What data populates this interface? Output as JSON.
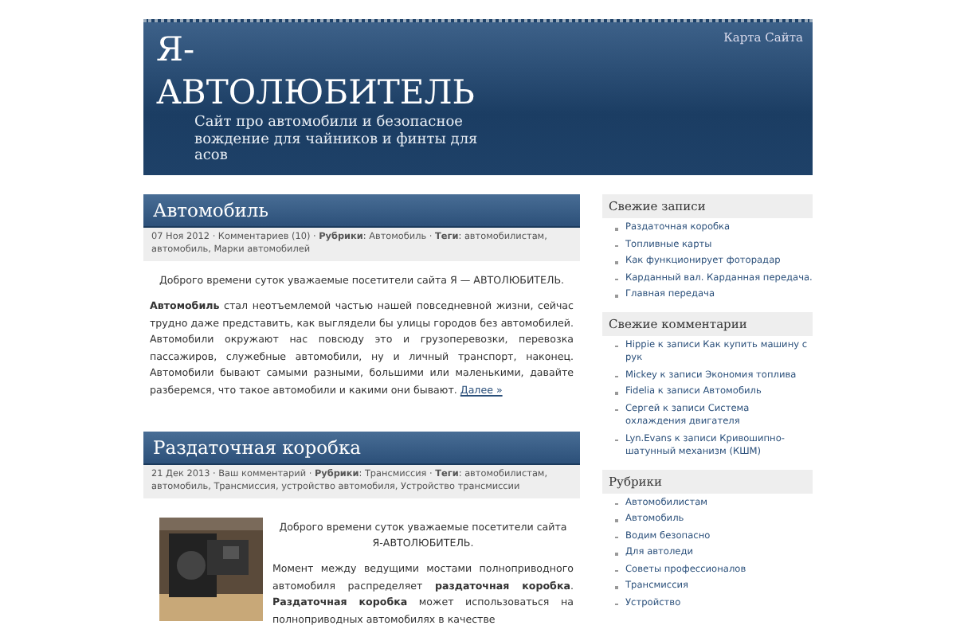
{
  "header": {
    "title_line_1": "Я-",
    "title_line_2": "АВТОЛЮБИТЕЛЬ",
    "description": "Сайт про автомобили и безопасное вождение для чайников и финты для асов",
    "nav_link": "Карта Сайта"
  },
  "posts": [
    {
      "title": "Автомобиль",
      "meta": "07 Ноя 2012 · Комментариев (10) · **Рубрики**: Автомобиль · **Теги**: автомобилистам, автомобиль, Марки автомобилей",
      "greeting": "Доброго времени суток уважаемые посетители сайта Я — АВТОЛЮБИТЕЛЬ.",
      "body": "**Автомобиль** стал неотъемлемой частью нашей повседневной жизни, сейчас трудно даже представить, как выглядели бы улицы городов без автомобилей. Автомобили окружают нас повсюду это и грузоперевозки, перевозка пассажиров, служебные автомобили, ну и личный транспорт, наконец. Автомобили бывают самыми разными, большими или маленькими, давайте разберемся, что такое автомобили и какими они бывают.",
      "more": "Далее »",
      "image": false
    },
    {
      "title": "Раздаточная коробка",
      "meta": "21 Дек 2013 · Ваш комментарий · **Рубрики**: Трансмиссия · **Теги**: автомобилистам, автомобиль, Трансмиссия, устройство автомобиля, Устройство трансмиссии",
      "greeting": "Доброго времени суток уважаемые посетители сайта Я-АВТОЛЮБИТЕЛЬ.",
      "body": "Момент между ведущими мостами полноприводного автомобиля распределяет **раздаточная коробка**. **Раздаточная коробка** может использоваться на полноприводных автомобилях в качестве",
      "image": true
    }
  ],
  "sidebar": [
    {
      "heading": "Свежие записи",
      "items": [
        "Раздаточная коробка",
        "Топливные карты",
        "Как функционирует фоторадар",
        "Карданный вал. Карданная передача.",
        "Главная передача"
      ]
    },
    {
      "heading": "Свежие комментарии",
      "items": [
        "Hippie к записи Как купить машину с рук",
        "Mickey к записи Экономия топлива",
        "Fidelia к записи Автомобиль",
        "Сергей к записи Система охлаждения двигателя",
        "Lyn.Evans к записи Кривошипно-шатунный механизм (КШМ)"
      ]
    },
    {
      "heading": "Рубрики",
      "items": [
        "Автомобилистам",
        "Автомобиль",
        "Водим безопасно",
        "Для автоледи",
        "Советы профессионалов",
        "Трансмиссия",
        "Устройство"
      ]
    }
  ]
}
